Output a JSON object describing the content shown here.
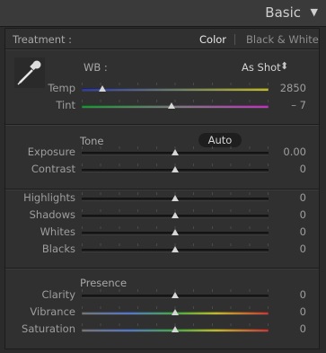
{
  "header": {
    "title": "Basic",
    "caret": "▼"
  },
  "treatment": {
    "label": "Treatment :",
    "color": "Color",
    "bw": "Black & White"
  },
  "wb": {
    "label": "WB :",
    "value": "As Shot",
    "arrows": "⬍"
  },
  "tone": {
    "label": "Tone",
    "auto": "Auto"
  },
  "presence": {
    "label": "Presence"
  },
  "sliders": [
    {
      "key": "temp",
      "label": "Temp",
      "value": "2850",
      "pos": 0.11,
      "gradient": "temp"
    },
    {
      "key": "tint",
      "label": "Tint",
      "value": "– 7",
      "pos": 0.48,
      "gradient": "tint"
    },
    {
      "key": "exposure",
      "label": "Exposure",
      "value": "0.00",
      "pos": 0.5,
      "gradient": "none"
    },
    {
      "key": "contrast",
      "label": "Contrast",
      "value": "0",
      "pos": 0.5,
      "gradient": "none"
    },
    {
      "key": "highlights",
      "label": "Highlights",
      "value": "0",
      "pos": 0.5,
      "gradient": "none"
    },
    {
      "key": "shadows",
      "label": "Shadows",
      "value": "0",
      "pos": 0.5,
      "gradient": "none"
    },
    {
      "key": "whites",
      "label": "Whites",
      "value": "0",
      "pos": 0.5,
      "gradient": "none"
    },
    {
      "key": "blacks",
      "label": "Blacks",
      "value": "0",
      "pos": 0.5,
      "gradient": "none"
    },
    {
      "key": "clarity",
      "label": "Clarity",
      "value": "0",
      "pos": 0.5,
      "gradient": "none"
    },
    {
      "key": "vibrance",
      "label": "Vibrance",
      "value": "0",
      "pos": 0.5,
      "gradient": "sat"
    },
    {
      "key": "saturation",
      "label": "Saturation",
      "value": "0",
      "pos": 0.5,
      "gradient": "sat"
    }
  ],
  "colors": {
    "accent_text": "#e8e8e8",
    "panel": "#303030",
    "header": "#3a3a3a"
  }
}
